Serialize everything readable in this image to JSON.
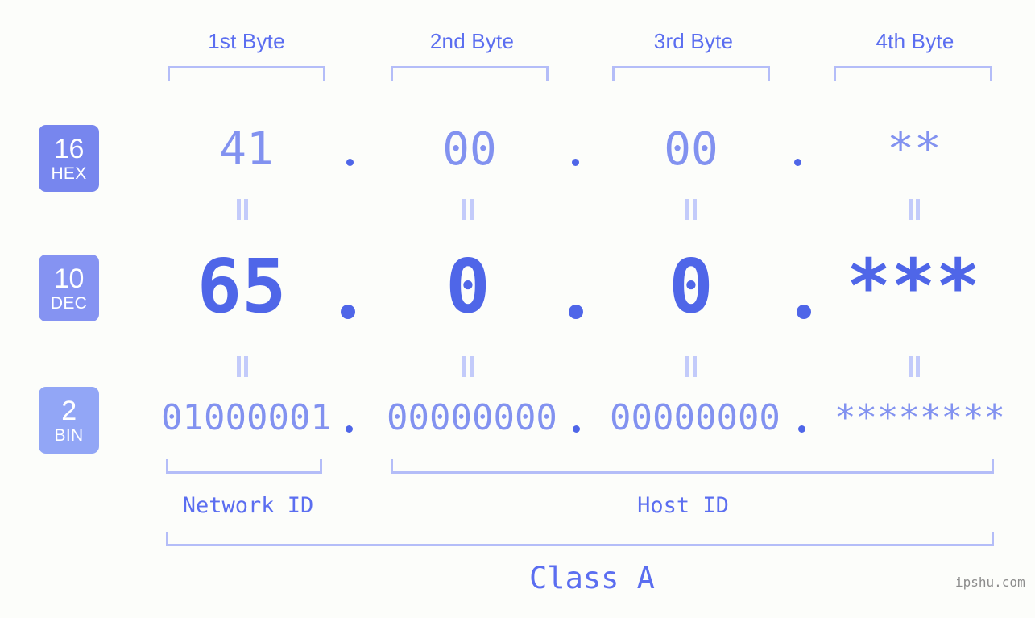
{
  "meta": {
    "background_color": "#fcfdfa",
    "accent_strong": "#4f66e8",
    "accent_light": "#8292f0",
    "bracket_color": "#b4bdf8",
    "equals_color": "#c3cbfa"
  },
  "headers": [
    {
      "label": "1st Byte"
    },
    {
      "label": "2nd Byte"
    },
    {
      "label": "3rd Byte"
    },
    {
      "label": "4th Byte"
    }
  ],
  "rows": [
    {
      "base": "16",
      "abbr": "HEX",
      "badge_color": "#7786ee",
      "values": [
        "41",
        "00",
        "00",
        "**"
      ]
    },
    {
      "base": "10",
      "abbr": "DEC",
      "badge_color": "#8593f2",
      "values": [
        "65",
        "0",
        "0",
        "***"
      ]
    },
    {
      "base": "2",
      "abbr": "BIN",
      "badge_color": "#92a6f6",
      "values": [
        "01000001",
        "00000000",
        "00000000",
        "********"
      ]
    }
  ],
  "separator": ".",
  "sections": [
    {
      "label": "Network ID"
    },
    {
      "label": "Host ID"
    }
  ],
  "class_label": "Class A",
  "watermark": "ipshu.com"
}
